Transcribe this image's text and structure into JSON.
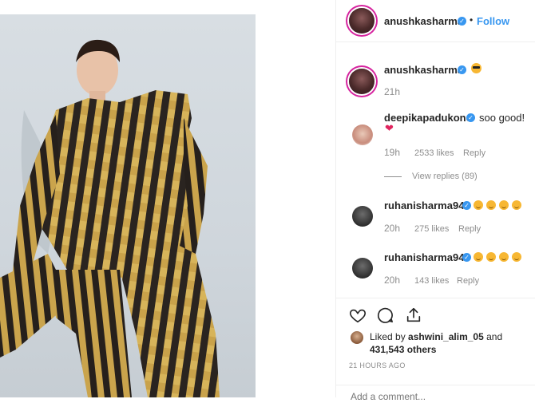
{
  "post": {
    "author": "anushkasharma",
    "follow_label": "Follow",
    "separator": "•"
  },
  "comments": [
    {
      "username": "anushkasharma",
      "text": "",
      "emoji": "sunglasses",
      "time": "21h"
    },
    {
      "username": "deepikapadukone",
      "text": "soo good!",
      "emoji": "red-heart",
      "time": "19h",
      "likes": "2533 likes",
      "reply": "Reply",
      "view_replies": "View replies (89)"
    },
    {
      "username": "ruhanisharma94",
      "emoji": "face-blowing-kiss x4",
      "time": "20h",
      "likes": "275 likes",
      "reply": "Reply"
    },
    {
      "username": "ruhanisharma94",
      "emoji": "face-blowing-kiss x4",
      "time": "20h",
      "likes": "143 likes",
      "reply": "Reply"
    }
  ],
  "engagement": {
    "liked_by_prefix": "Liked by",
    "liked_by_user": "ashwini_alim_05",
    "and": "and",
    "others_count": "431,543 others",
    "timestamp": "21 HOURS AGO"
  },
  "add_comment": {
    "placeholder": "Add a comment..."
  },
  "colors": {
    "link_blue": "#3897f0",
    "heart_red": "#e0245e",
    "muted": "#8e8e8e",
    "text": "#262626"
  }
}
